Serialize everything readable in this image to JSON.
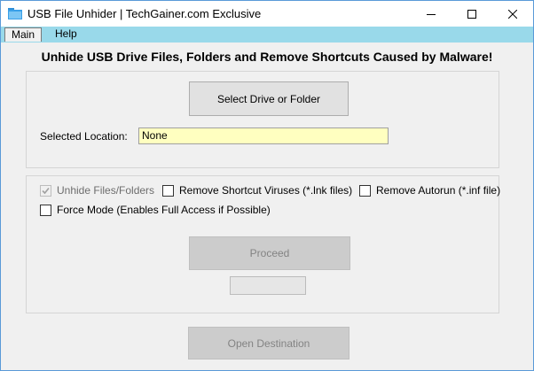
{
  "window": {
    "title": "USB File Unhider | TechGainer.com Exclusive"
  },
  "menu": {
    "items": [
      {
        "label": "Main"
      },
      {
        "label": "Help"
      }
    ]
  },
  "heading": "Unhide USB Drive Files, Folders and Remove Shortcuts Caused by Malware!",
  "location_group": {
    "select_button": "Select Drive or Folder",
    "selected_label": "Selected Location:",
    "selected_value": "None"
  },
  "options": {
    "unhide": {
      "label": "Unhide Files/Folders",
      "checked": true,
      "enabled": false
    },
    "shortcut": {
      "label": "Remove Shortcut Viruses (*.lnk files)",
      "checked": false
    },
    "autorun": {
      "label": "Remove Autorun (*.inf file)",
      "checked": false
    },
    "force": {
      "label": "Force Mode (Enables Full Access if Possible)",
      "checked": false
    }
  },
  "actions": {
    "proceed": "Proceed",
    "progress": 0,
    "open_destination": "Open Destination"
  },
  "colors": {
    "menubar": "#99d9ea",
    "input_bg": "#ffffc0",
    "window_border": "#5a9ad8"
  }
}
